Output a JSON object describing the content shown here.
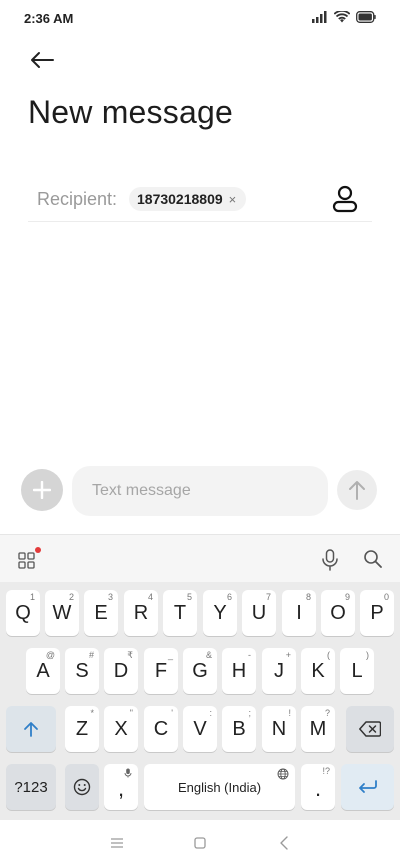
{
  "status_bar": {
    "time": "2:36 AM",
    "icons": [
      "signal-icon",
      "wifi-icon",
      "battery-icon"
    ]
  },
  "header": {
    "back_icon": "arrow-left-icon",
    "title": "New message"
  },
  "recipient": {
    "label": "Recipient:",
    "chip_text": "18730218809",
    "chip_close": "×",
    "contact_icon": "person-icon"
  },
  "compose": {
    "attach_icon": "plus-icon",
    "placeholder": "Text message",
    "value": "",
    "send_icon": "arrow-up-icon"
  },
  "keyboard": {
    "toolbar_icons": [
      "apps-grid-icon",
      "microphone-icon",
      "search-icon"
    ],
    "rows": [
      [
        {
          "label": "Q",
          "hint": "1"
        },
        {
          "label": "W",
          "hint": "2"
        },
        {
          "label": "E",
          "hint": "3"
        },
        {
          "label": "R",
          "hint": "4"
        },
        {
          "label": "T",
          "hint": "5"
        },
        {
          "label": "Y",
          "hint": "6"
        },
        {
          "label": "U",
          "hint": "7"
        },
        {
          "label": "I",
          "hint": "8"
        },
        {
          "label": "O",
          "hint": "9"
        },
        {
          "label": "P",
          "hint": "0"
        }
      ],
      [
        {
          "label": "A",
          "hint": "@"
        },
        {
          "label": "S",
          "hint": "#"
        },
        {
          "label": "D",
          "hint": "₹"
        },
        {
          "label": "F",
          "hint": "_"
        },
        {
          "label": "G",
          "hint": "&"
        },
        {
          "label": "H",
          "hint": "-"
        },
        {
          "label": "J",
          "hint": "+"
        },
        {
          "label": "K",
          "hint": "("
        },
        {
          "label": "L",
          "hint": ")"
        }
      ],
      [
        {
          "label": "Z",
          "hint": "*"
        },
        {
          "label": "X",
          "hint": "\""
        },
        {
          "label": "C",
          "hint": "'"
        },
        {
          "label": "V",
          "hint": ":"
        },
        {
          "label": "B",
          "hint": ";"
        },
        {
          "label": "N",
          "hint": "!"
        },
        {
          "label": "M",
          "hint": "?"
        }
      ]
    ],
    "shift_icon": "shift-arrow-icon",
    "backspace_icon": "backspace-icon",
    "symbols_label": "?123",
    "emoji_icon": "emoji-icon",
    "comma_label": ",",
    "space_label": "English (India)",
    "space_icon": "globe-icon",
    "period_label": ".",
    "period_hint": "!?",
    "enter_icon": "enter-arrow-icon"
  },
  "nav_bar": {
    "icons": [
      "menu-icon",
      "home-square-icon",
      "back-chevron-icon"
    ]
  },
  "colors": {
    "accent": "#2f7fc8",
    "badge": "#e33b3b"
  }
}
